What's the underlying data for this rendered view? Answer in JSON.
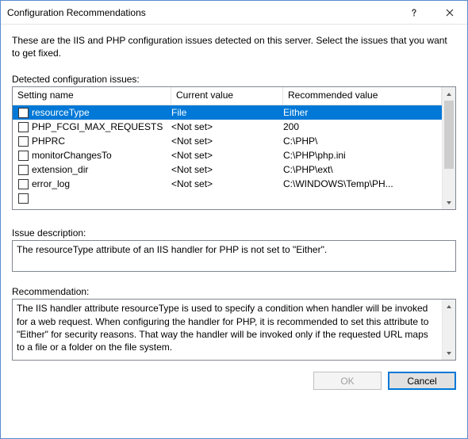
{
  "window": {
    "title": "Configuration Recommendations"
  },
  "intro": "These are the IIS and PHP configuration issues detected on this server. Select the issues that you want to get fixed.",
  "labels": {
    "detected": "Detected configuration issues:",
    "issue_desc": "Issue description:",
    "recommendation": "Recommendation:"
  },
  "grid": {
    "columns": {
      "setting": "Setting name",
      "current": "Current value",
      "recommended": "Recommended value"
    },
    "rows": [
      {
        "setting": "resourceType",
        "current": "File",
        "recommended": "Either",
        "selected": true
      },
      {
        "setting": "PHP_FCGI_MAX_REQUESTS",
        "current": "<Not set>",
        "recommended": "200"
      },
      {
        "setting": "PHPRC",
        "current": "<Not set>",
        "recommended": "C:\\PHP\\"
      },
      {
        "setting": "monitorChangesTo",
        "current": "<Not set>",
        "recommended": "C:\\PHP\\php.ini"
      },
      {
        "setting": "extension_dir",
        "current": "<Not set>",
        "recommended": "C:\\PHP\\ext\\"
      },
      {
        "setting": "error_log",
        "current": "<Not set>",
        "recommended": "C:\\WINDOWS\\Temp\\PH..."
      }
    ]
  },
  "issue_description": "The resourceType attribute of an IIS handler for PHP is not set to \"Either\".",
  "recommendation_text": "The IIS handler attribute resourceType is used to specify a condition when handler will be invoked for a web request. When configuring the handler for PHP, it is recommended to set this attribute to \"Either\" for security reasons. That way the handler will be invoked only if the requested URL maps to a file or a folder on the file system.",
  "buttons": {
    "ok": "OK",
    "cancel": "Cancel"
  }
}
